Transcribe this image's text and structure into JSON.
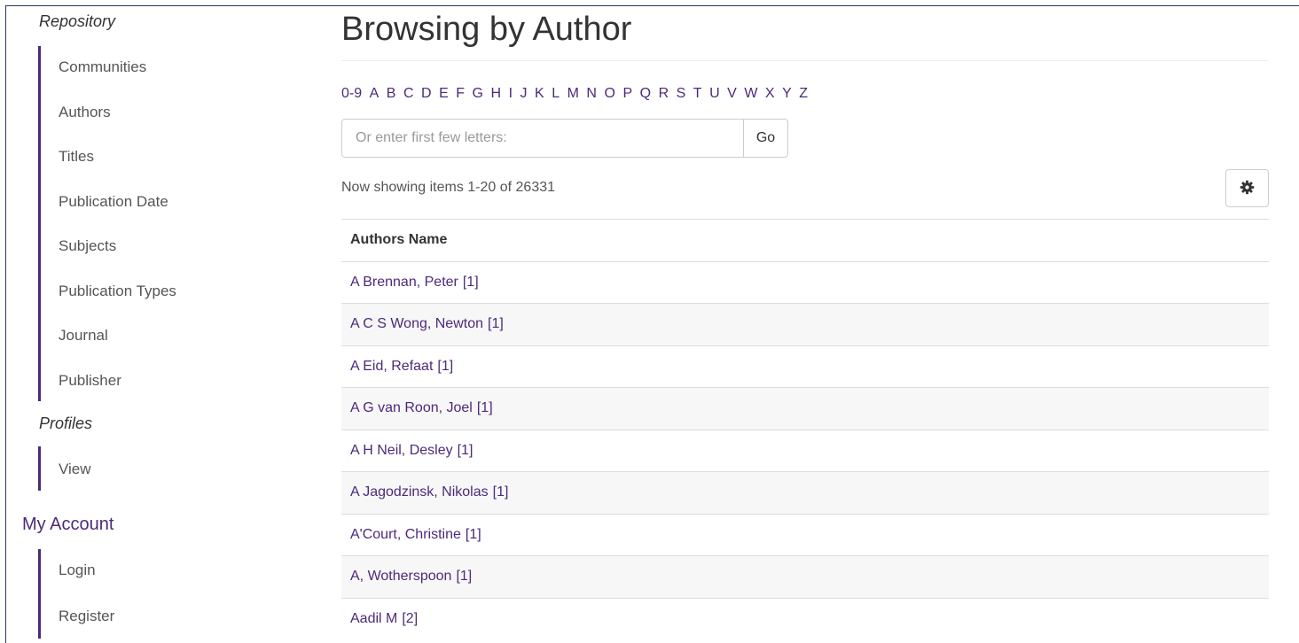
{
  "sidebar": {
    "repository_heading": "Repository",
    "browse_items": [
      {
        "label": "Communities"
      },
      {
        "label": "Authors"
      },
      {
        "label": "Titles"
      },
      {
        "label": "Publication Date"
      },
      {
        "label": "Subjects"
      },
      {
        "label": "Publication Types"
      },
      {
        "label": "Journal"
      },
      {
        "label": "Publisher"
      }
    ],
    "profiles_heading": "Profiles",
    "profiles_items": [
      {
        "label": "View"
      }
    ],
    "account_heading": "My Account",
    "account_items": [
      {
        "label": "Login"
      },
      {
        "label": "Register"
      }
    ]
  },
  "main": {
    "title": "Browsing by Author",
    "letters": [
      "0-9",
      "A",
      "B",
      "C",
      "D",
      "E",
      "F",
      "G",
      "H",
      "I",
      "J",
      "K",
      "L",
      "M",
      "N",
      "O",
      "P",
      "Q",
      "R",
      "S",
      "T",
      "U",
      "V",
      "W",
      "X",
      "Y",
      "Z"
    ],
    "search": {
      "placeholder": "Or enter first few letters:",
      "value": "",
      "go_label": "Go"
    },
    "showing_text": "Now showing items 1-20 of 26331",
    "settings_icon": "gear-icon",
    "table": {
      "header": "Authors Name",
      "rows": [
        {
          "name": "A Brennan, Peter",
          "count": "[1]"
        },
        {
          "name": "A C S Wong, Newton",
          "count": "[1]"
        },
        {
          "name": "A Eid, Refaat",
          "count": "[1]"
        },
        {
          "name": "A G van Roon, Joel",
          "count": "[1]"
        },
        {
          "name": "A H Neil, Desley",
          "count": "[1]"
        },
        {
          "name": "A Jagodzinsk, Nikolas",
          "count": "[1]"
        },
        {
          "name": "A'Court, Christine",
          "count": "[1]"
        },
        {
          "name": "A, Wotherspoon",
          "count": "[1]"
        },
        {
          "name": "Aadil M",
          "count": "[2]"
        }
      ]
    }
  },
  "colors": {
    "accent": "#4b2a7a",
    "frame": "#24365f",
    "row_alt": "#f7f7f7"
  }
}
